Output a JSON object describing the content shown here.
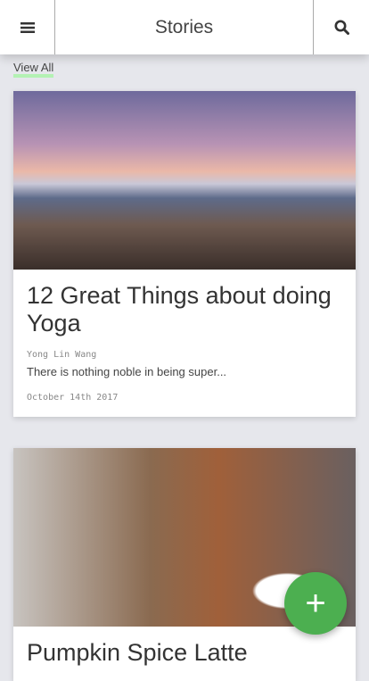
{
  "header": {
    "title": "Stories",
    "menu_icon": "hamburger-icon",
    "search_icon": "search-icon"
  },
  "view_all": "View All",
  "stories": [
    {
      "title": "12 Great Things about doing Yoga",
      "author": "Yong Lin Wang",
      "excerpt": "There is nothing noble in being super...",
      "date": "October 14th 2017"
    },
    {
      "title": "Pumpkin Spice Latte"
    }
  ],
  "fab": {
    "label": "+",
    "icon": "plus-icon",
    "color": "#4caf50"
  }
}
